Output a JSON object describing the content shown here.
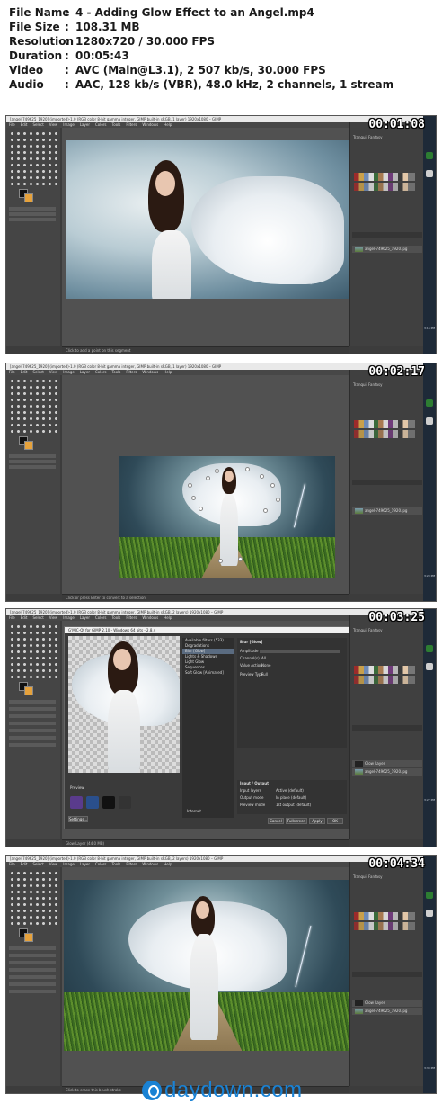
{
  "info": [
    {
      "key": "File Name",
      "value": "4 - Adding Glow Effect to an Angel.mp4"
    },
    {
      "key": "File Size",
      "value": "108.31 MB"
    },
    {
      "key": "Resolution",
      "value": "1280x720 / 30.000 FPS"
    },
    {
      "key": "Duration",
      "value": "00:05:43"
    },
    {
      "key": "Video",
      "value": "AVC (Main@L3.1), 2 507 kb/s, 30.000 FPS"
    },
    {
      "key": "Audio",
      "value": "AAC, 128 kb/s (VBR), 48.0 kHz, 2 channels, 1 stream"
    }
  ],
  "separator": ":",
  "frames": [
    {
      "timestamp": "00:01:08",
      "window_title": "[angel-749625_1920] (imported)-1.0 (RGB color 8-bit gamma integer, GIMP built-in sRGB, 1 layer) 1920x1080 – GIMP",
      "status_text": "Click to add a point on this segment",
      "brush_label": "Tranquil Fantasy",
      "layers": [
        "angel-749625_1920.jpg"
      ],
      "clock": "3:16 PM"
    },
    {
      "timestamp": "00:02:17",
      "window_title": "[angel-749625_1920] (imported)-1.0 (RGB color 8-bit gamma integer, GIMP built-in sRGB, 1 layer) 1920x1080 – GIMP",
      "status_text": "Click or press Enter to convert to a selection",
      "brush_label": "Tranquil Fantasy",
      "layers": [
        "angel-749625_1920.jpg"
      ],
      "clock": "3:20 PM"
    },
    {
      "timestamp": "00:03:25",
      "window_title": "[angel-749625_1920] (imported)-1.0 (RGB color 8-bit gamma integer, GIMP built-in sRGB, 2 layers) 1920x1080 – GIMP",
      "status_text": "Glow Layer (44.0 MB)",
      "brush_label": "Tranquil Fantasy",
      "layers": [
        "Glow Layer",
        "angel-749625_1920.jpg"
      ],
      "clock": "3:27 PM",
      "dialog": {
        "title": "G'MIC-Qt for GIMP 2.10 - Windows 64 bits - 2.8.4",
        "filter_header": "Available filters (533)",
        "filters": [
          "Degradations",
          "Blur [Glow]",
          "Lights & Shadows",
          "Light Glow",
          "Sequences",
          "Soft Glow [Animated]"
        ],
        "selected_filter": "Blur [Glow]",
        "params_title": "Blur [Glow]",
        "params": [
          {
            "label": "Amplitude",
            "value": "3"
          },
          {
            "label": "Channel(s)",
            "value": "All"
          },
          {
            "label": "Value Action",
            "value": "None"
          },
          {
            "label": "Preview Type",
            "value": "Full"
          }
        ],
        "io_title": "Input / Output",
        "io_rows": [
          {
            "label": "Input layers",
            "value": "Active (default)"
          },
          {
            "label": "Output mode",
            "value": "In place (default)"
          },
          {
            "label": "Preview mode",
            "value": "1st output (default)"
          }
        ],
        "buttons": {
          "settings": "Settings...",
          "cancel": "Cancel",
          "fullscreen": "Fullscreen",
          "apply": "Apply",
          "ok": "OK"
        },
        "internet_label": "Internet",
        "preview_label": "Preview"
      }
    },
    {
      "timestamp": "00:04:34",
      "window_title": "[angel-749625_1920] (imported)-1.0 (RGB color 8-bit gamma integer, GIMP built-in sRGB, 2 layers) 1920x1080 – GIMP",
      "status_text": "Click to erase this brush stroke",
      "brush_label": "Tranquil Fantasy",
      "layers": [
        "Glow Layer",
        "angel-749625_1920.jpg"
      ],
      "clock": "3:30 PM"
    }
  ],
  "menu": [
    "File",
    "Edit",
    "Select",
    "View",
    "Image",
    "Layer",
    "Colors",
    "Tools",
    "Filters",
    "Windows",
    "Help"
  ],
  "watermark": "daydown.com",
  "colors": {
    "watermark": "#1a82d4",
    "gimp_bg": "#3c3c3c",
    "taskbar": "#1e2a38"
  }
}
